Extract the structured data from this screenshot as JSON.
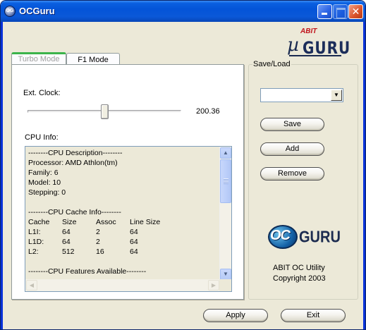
{
  "window": {
    "title": "OCGuru",
    "icon_text": "OG"
  },
  "logos": {
    "abit": "ABIT",
    "mu": "µ",
    "guru": "GURU",
    "oc": "OC",
    "oc_guru": "GURU"
  },
  "tabs": [
    {
      "label": "Turbo Mode"
    },
    {
      "label": "F1 Mode"
    }
  ],
  "turbo": {
    "ext_clock_label": "Ext. Clock:",
    "ext_clock_value": "200.36",
    "slider_fraction": 0.5,
    "cpu_info_label": "CPU Info:",
    "cpu_info": {
      "description_header": "--------CPU Description--------",
      "processor": "Processor: AMD Athlon(tm)",
      "family": "Family: 6",
      "model": "Model: 10",
      "stepping": "Stepping: 0",
      "cache_header": "--------CPU Cache Info--------",
      "cache_columns": [
        "Cache",
        "Size",
        "Assoc",
        "Line Size"
      ],
      "cache_rows": [
        [
          "L1I:",
          "64",
          "2",
          "64"
        ],
        [
          "L1D:",
          "64",
          "2",
          "64"
        ],
        [
          "L2:",
          "512",
          "16",
          "64"
        ]
      ],
      "features_header": "--------CPU Features Available--------"
    }
  },
  "save_load": {
    "label": "Save/Load",
    "profile_value": "",
    "save": "Save",
    "add": "Add",
    "remove": "Remove",
    "util_name": "ABIT OC Utility",
    "copyright": "Copyright 2003"
  },
  "footer": {
    "apply": "Apply",
    "exit": "Exit"
  }
}
